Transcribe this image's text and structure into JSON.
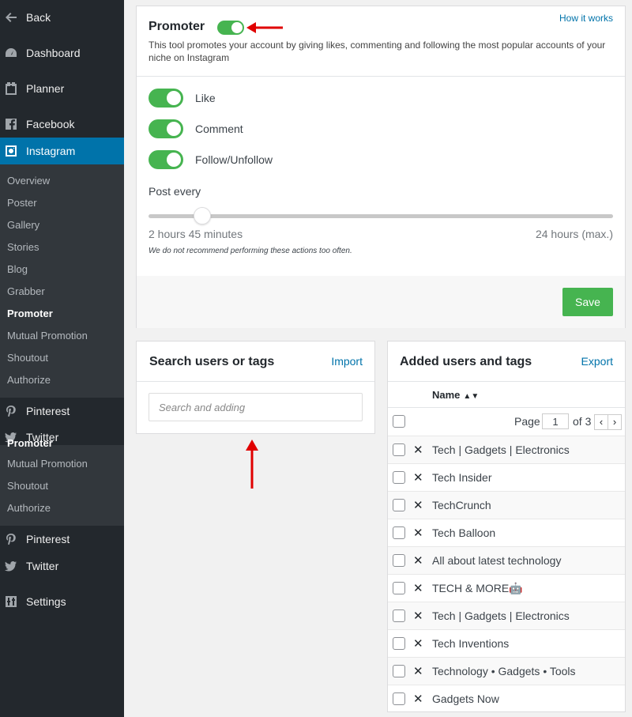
{
  "sidebar": {
    "top": [
      {
        "label": "Back",
        "icon": "arrow-left-icon"
      },
      {
        "label": "Dashboard",
        "icon": "dashboard-icon"
      },
      {
        "label": "Planner",
        "icon": "calendar-icon"
      },
      {
        "label": "Facebook",
        "icon": "facebook-icon"
      },
      {
        "label": "Instagram",
        "icon": "instagram-icon"
      }
    ],
    "submenu": [
      "Overview",
      "Poster",
      "Gallery",
      "Stories",
      "Blog",
      "Grabber",
      "Promoter",
      "Mutual Promotion",
      "Shoutout",
      "Authorize"
    ],
    "current": "Promoter",
    "bottom1": [
      {
        "label": "Pinterest",
        "icon": "pinterest-icon"
      },
      {
        "label": "Twitter",
        "icon": "twitter-icon"
      }
    ],
    "ghost_label": "Promoter",
    "submenu2": [
      "Mutual Promotion",
      "Shoutout",
      "Authorize"
    ],
    "bottom2": [
      {
        "label": "Pinterest",
        "icon": "pinterest-icon"
      },
      {
        "label": "Twitter",
        "icon": "twitter-icon"
      },
      {
        "label": "Settings",
        "icon": "settings-icon"
      }
    ]
  },
  "promoter": {
    "title": "Promoter",
    "enabled": true,
    "how_link": "How it works",
    "description": "This tool promotes your account by giving likes, commenting and following the most popular accounts of your niche on Instagram",
    "toggles": [
      {
        "label": "Like",
        "on": true
      },
      {
        "label": "Comment",
        "on": true
      },
      {
        "label": "Follow/Unfollow",
        "on": true
      }
    ],
    "post_every_label": "Post every",
    "slider_value": "2 hours 45 minutes",
    "slider_max": "24 hours (max.)",
    "slider_fraction": 0.115,
    "warning": "We do not recommend performing these actions too often.",
    "save_label": "Save"
  },
  "search": {
    "title": "Search users or tags",
    "import_label": "Import",
    "placeholder": "Search and adding"
  },
  "added": {
    "title": "Added users and tags",
    "export_label": "Export",
    "name_col": "Name",
    "page_label": "Page",
    "page_value": "1",
    "of_label": "of 3",
    "items": [
      "Tech | Gadgets | Electronics",
      "Tech Insider",
      "TechCrunch",
      "Tech Balloon",
      "All about latest technology",
      "TECH & MORE🤖",
      "Tech | Gadgets | Electronics",
      "Tech Inventions",
      "Technology • Gadgets • Tools",
      "Gadgets Now"
    ]
  },
  "colors": {
    "sidebar_bg": "#23282d",
    "active_bg": "#0073aa",
    "toggle_on": "#46b450",
    "link": "#0073aa",
    "arrow": "#e00000"
  }
}
